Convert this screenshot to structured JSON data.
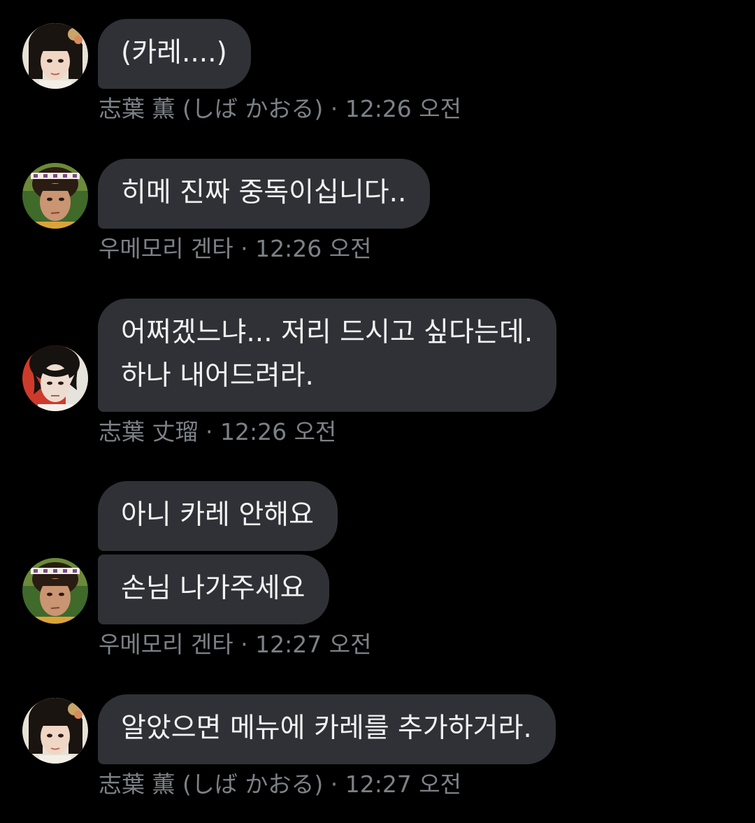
{
  "messages": [
    {
      "avatar": "avatar-kaoru",
      "bubbles": [
        "(카레....)"
      ],
      "sender": "志葉 薫 (しば かおる)",
      "time": "12:26 오전"
    },
    {
      "avatar": "avatar-genta",
      "bubbles": [
        "히메 진짜 중독이십니다.."
      ],
      "sender": "우메모리 겐타",
      "time": "12:26 오전"
    },
    {
      "avatar": "avatar-takeru",
      "bubbles": [
        "어쩌겠느냐... 저리 드시고 싶다는데.",
        "하나 내어드려라."
      ],
      "sender": "志葉 丈瑠",
      "time": "12:26 오전"
    },
    {
      "avatar": "avatar-genta",
      "bubbles": [
        "아니 카레 안해요",
        "손님 나가주세요"
      ],
      "sender": "우메모리 겐타",
      "time": "12:27 오전"
    },
    {
      "avatar": "avatar-kaoru",
      "bubbles": [
        "알았으면 메뉴에 카레를 추가하거라."
      ],
      "sender": "志葉 薫 (しば かおる)",
      "time": "12:27 오전"
    }
  ],
  "separator": " · ",
  "colors": {
    "background": "#000000",
    "bubble": "#2f3136",
    "bubble_text": "#f2f2f2",
    "meta_text": "#7c8186"
  }
}
